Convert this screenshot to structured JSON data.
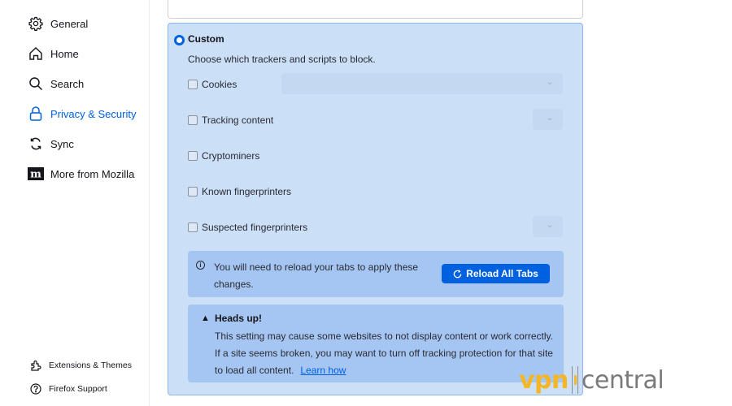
{
  "sidebar": {
    "items": [
      {
        "label": "General",
        "icon": "gear-icon",
        "selected": false
      },
      {
        "label": "Home",
        "icon": "home-icon",
        "selected": false
      },
      {
        "label": "Search",
        "icon": "search-icon",
        "selected": false
      },
      {
        "label": "Privacy & Security",
        "icon": "lock-icon",
        "selected": true
      },
      {
        "label": "Sync",
        "icon": "sync-icon",
        "selected": false
      },
      {
        "label": "More from Mozilla",
        "icon": "mozilla-icon",
        "selected": false
      }
    ],
    "footer": [
      {
        "label": "Extensions & Themes",
        "icon": "puzzle-icon"
      },
      {
        "label": "Firefox Support",
        "icon": "help-icon"
      }
    ]
  },
  "custom": {
    "label": "Custom",
    "selected": true,
    "description": "Choose which trackers and scripts to block.",
    "options": [
      {
        "label": "Cookies",
        "checked": false,
        "has_select": true
      },
      {
        "label": "Tracking content",
        "checked": false,
        "has_select": true
      },
      {
        "label": "Cryptominers",
        "checked": false,
        "has_select": false
      },
      {
        "label": "Known fingerprinters",
        "checked": false,
        "has_select": false
      },
      {
        "label": "Suspected fingerprinters",
        "checked": false,
        "has_select": true
      }
    ],
    "reload_notice": {
      "text": "You will need to reload your tabs to apply these changes.",
      "button_label": "Reload All Tabs"
    },
    "warning": {
      "title": "Heads up!",
      "text": "This setting may cause some websites to not display content or work correctly. If a site seems broken, you may want to turn off tracking protection for that site to load all content.",
      "link_label": "Learn how"
    }
  },
  "watermark": {
    "brand_part1": "vpn",
    "brand_part2": "central"
  },
  "colors": {
    "accent": "#0061e0",
    "panel_bg": "#cbdff7",
    "notice_bg": "#a5c6f2",
    "watermark_yellow": "#f5b625"
  }
}
